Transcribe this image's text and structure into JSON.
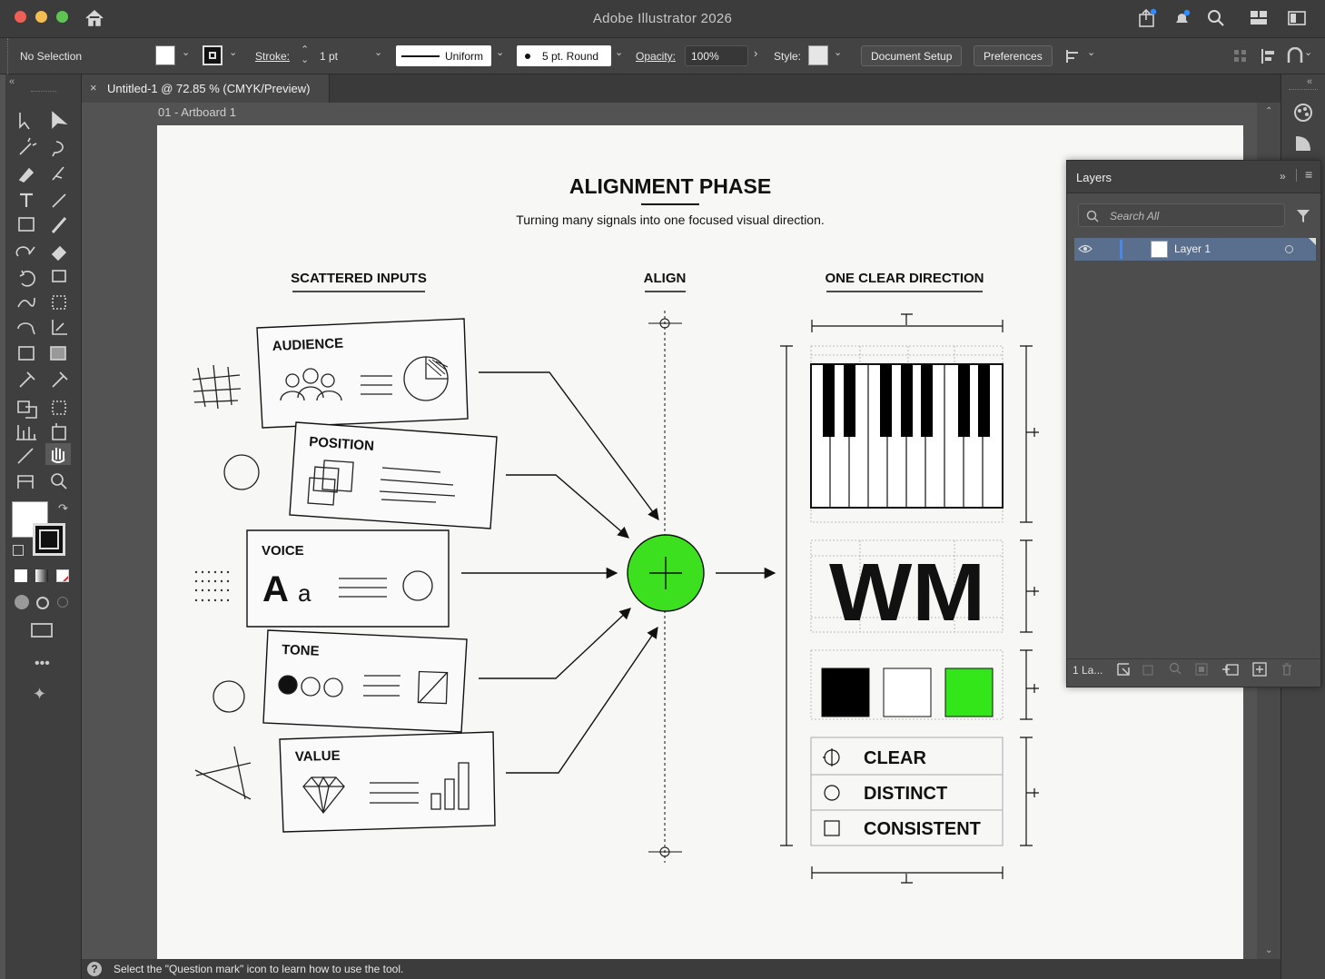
{
  "window": {
    "title": "Adobe Illustrator 2026"
  },
  "control_bar": {
    "selection": "No Selection",
    "stroke_label": "Stroke:",
    "stroke_weight": "1 pt",
    "stroke_profile": "Uniform",
    "brush": "5 pt. Round",
    "opacity_label": "Opacity:",
    "opacity_value": "100%",
    "style_label": "Style:",
    "document_setup": "Document Setup",
    "preferences": "Preferences"
  },
  "document": {
    "tab_title": "Untitled-1 @ 72.85 % (CMYK/Preview)",
    "artboard_label": "01 - Artboard 1"
  },
  "artwork": {
    "title": "ALIGNMENT PHASE",
    "subtitle": "Turning many signals into one focused visual direction.",
    "col_left": "SCATTERED INPUTS",
    "col_mid": "ALIGN",
    "col_right": "ONE CLEAR DIRECTION",
    "cards": [
      "AUDIENCE",
      "POSITION",
      "VOICE",
      "TONE",
      "VALUE"
    ],
    "voice_glyph_big": "A",
    "voice_glyph_small": "a",
    "logo_text": "WM",
    "palette": [
      "#000000",
      "#ffffff",
      "#33e61a"
    ],
    "accent_color": "#3ce01e",
    "attributes": [
      "CLEAR",
      "DISTINCT",
      "CONSISTENT"
    ]
  },
  "layers_panel": {
    "title": "Layers",
    "search_placeholder": "Search All",
    "layer_name": "Layer 1",
    "footer_count": "1 La..."
  },
  "status": {
    "hint": "Select the \"Question mark\" icon to learn how to use the tool."
  }
}
